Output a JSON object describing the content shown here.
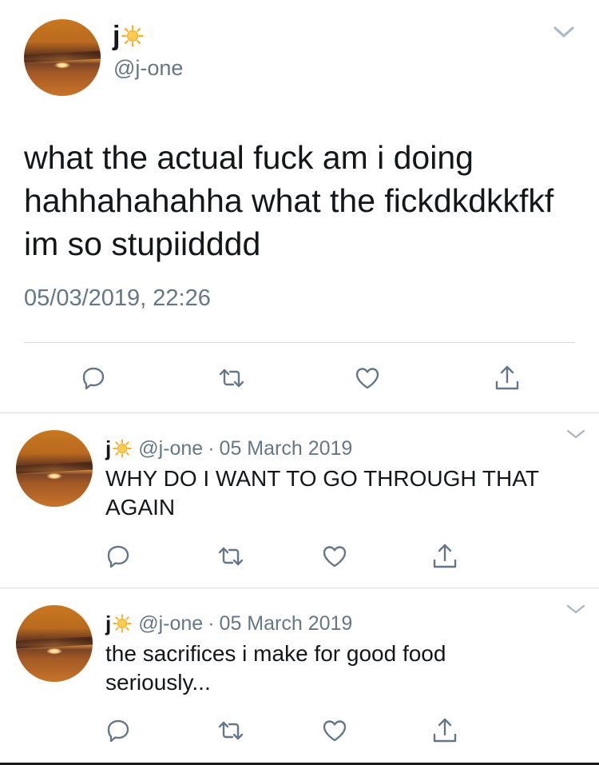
{
  "main_tweet": {
    "name": "j",
    "emoji": "sun-icon",
    "handle": "@j-one",
    "text": "what the actual fuck am i doing\nhahhahahahha what the fickdkdkkfkf\nim so stupiidddd",
    "timestamp": "05/03/2019, 22:26"
  },
  "replies": [
    {
      "name": "j",
      "emoji": "sun-icon",
      "handle": "@j-one",
      "separator": "·",
      "date": "05 March 2019",
      "text": "WHY DO I WANT TO GO THROUGH THAT\nAGAIN"
    },
    {
      "name": "j",
      "emoji": "sun-icon",
      "handle": "@j-one",
      "separator": "·",
      "date": "05 March 2019",
      "text": "the sacrifices i make for good food\nseriously..."
    }
  ],
  "icons": {
    "reply": "reply-icon",
    "retweet": "retweet-icon",
    "like": "heart-icon",
    "share": "share-icon",
    "more": "chevron-down-icon"
  },
  "colors": {
    "text": "#14171a",
    "secondary": "#657786",
    "divider": "#d7dde2",
    "sun": "#ffad1f"
  }
}
